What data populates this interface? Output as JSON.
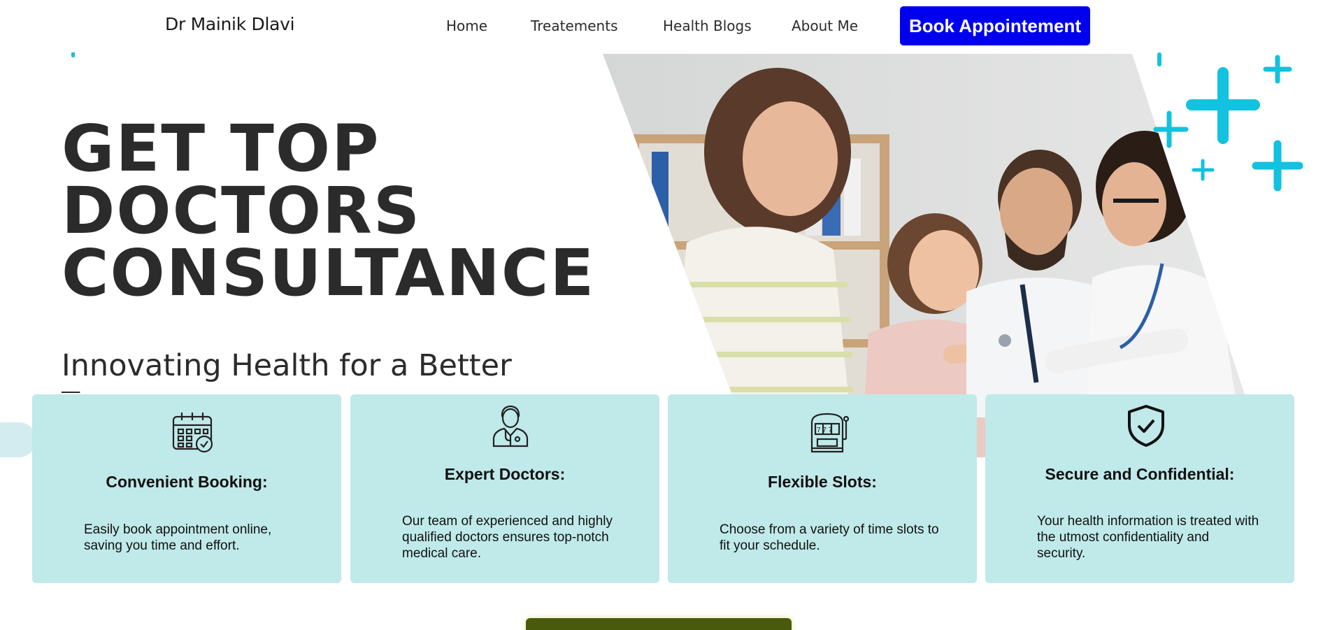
{
  "header": {
    "brand": "Dr Mainik Dlavi",
    "nav": [
      "Home",
      "Treatements",
      "Health Blogs",
      "About Me"
    ],
    "cta_label": "Book Appointement"
  },
  "hero": {
    "title_lines": [
      "GET TOP",
      "DOCTORS",
      "CONSULTANCE"
    ],
    "subtitle": "Innovating Health for a Better Tomorrow",
    "image": "doctor-examining-child-with-parents-photo"
  },
  "features": [
    {
      "icon": "calendar-check-icon",
      "title": "Convenient Booking:",
      "description": "Easily book appointment online, saving you time and effort."
    },
    {
      "icon": "doctor-icon",
      "title": "Expert Doctors:",
      "description": "Our team of experienced and highly qualified doctors ensures top-notch medical care."
    },
    {
      "icon": "slot-machine-icon",
      "title": "Flexible Slots:",
      "description": "Choose from a variety of time slots to fit your schedule."
    },
    {
      "icon": "shield-check-icon",
      "title": "Secure and Confidential:",
      "description": "Your health information is treated with the utmost confidentiality and security."
    }
  ],
  "colors": {
    "cta_background": "#0000ee",
    "card_background": "#c0e9ea",
    "accent_plus": "#12c2de",
    "heading_text": "#2b2b2b",
    "bottom_button": "#4a5a0c"
  }
}
